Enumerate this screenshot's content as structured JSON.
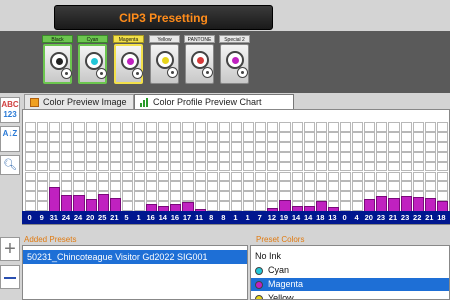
{
  "app": {
    "title": "CIP3 Presetting"
  },
  "stations": [
    {
      "label": "Black",
      "ink": "#222222",
      "state": "active"
    },
    {
      "label": "Cyan",
      "ink": "#22c7d8",
      "state": "active"
    },
    {
      "label": "Magenta",
      "ink": "#c021c0",
      "state": "selected"
    },
    {
      "label": "Yellow",
      "ink": "#e8d51a",
      "state": "normal"
    },
    {
      "label": "PANTONE 16",
      "ink": "#d63a3a",
      "state": "normal"
    },
    {
      "label": "Special 2",
      "ink": "#c021c0",
      "state": "normal"
    }
  ],
  "toolbar": {
    "abc_top": "ABC",
    "abc_bottom": "123",
    "az_label": "A↓Z"
  },
  "tabs": [
    {
      "label": "Color Preview Image",
      "icon": "image-icon"
    },
    {
      "label": "Color Profile Preview Chart",
      "icon": "bar-chart-icon"
    }
  ],
  "chart_data": {
    "type": "bar",
    "series": [
      {
        "color": "#c021c0"
      }
    ],
    "values": [
      0,
      9,
      31,
      24,
      24,
      20,
      25,
      21,
      5,
      1,
      16,
      14,
      16,
      17,
      11,
      8,
      8,
      1,
      1,
      7,
      12,
      19,
      14,
      14,
      18,
      13,
      0,
      4,
      20,
      23,
      21,
      23,
      22,
      21,
      18
    ],
    "grid_rows": 10,
    "ylim": [
      0,
      100
    ],
    "grid": true,
    "bar_color": "#c021c0"
  },
  "bottom": {
    "added_label": "Added Presets",
    "added_items": [
      "50231_Chincoteague Visitor Gd2022 SIG001"
    ],
    "preset_label": "Preset Colors",
    "preset_items": [
      {
        "label": "No Ink",
        "swatch": null,
        "selected": false
      },
      {
        "label": "Cyan",
        "swatch": "#22c7d8",
        "selected": false
      },
      {
        "label": "Magenta",
        "swatch": "#c021c0",
        "selected": true
      },
      {
        "label": "Yellow",
        "swatch": "#e8d51a",
        "selected": false
      }
    ]
  }
}
